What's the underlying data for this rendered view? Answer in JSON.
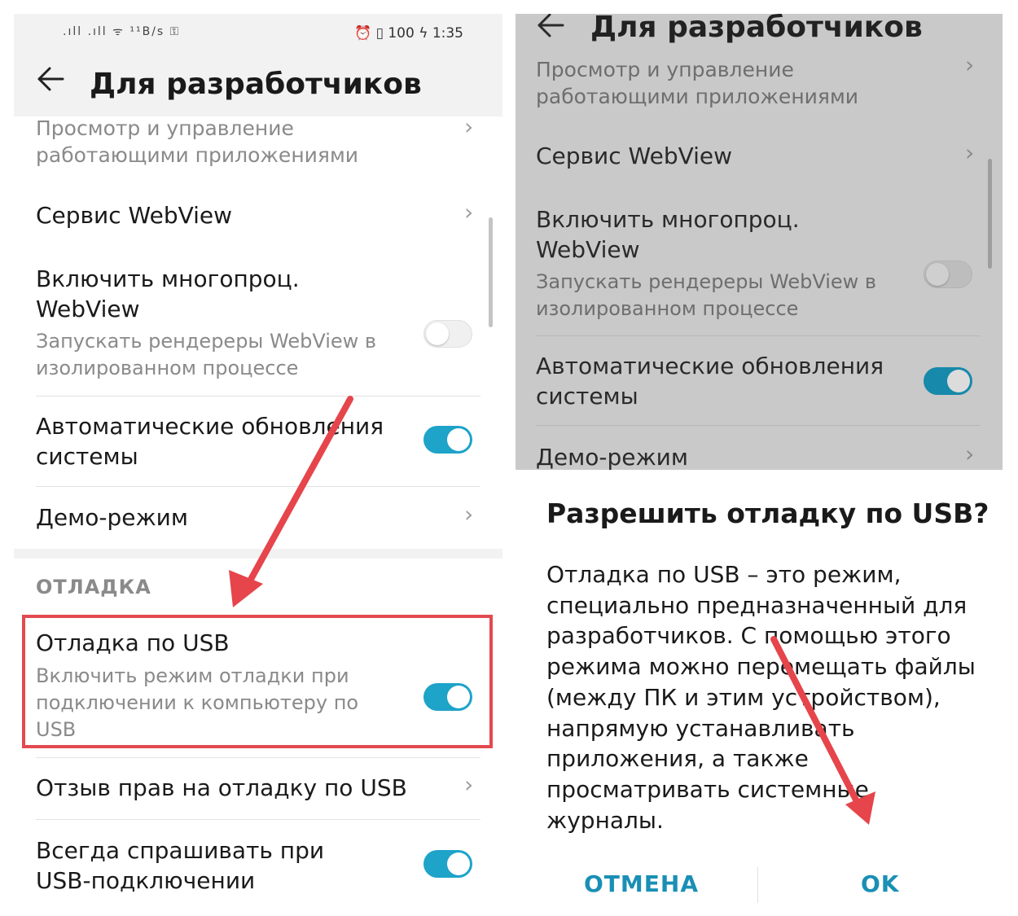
{
  "left": {
    "status_bar": {
      "left_icons": ".ıll  .ıll ᯤ ¹¹B/s  ⚿",
      "right_icons": "⏰ ▯ 100",
      "time": "1:35"
    },
    "header": {
      "title": "Для разработчиков"
    },
    "items": {
      "running_apps": {
        "title_line1": "Просмотр и управление",
        "title_line2": "работающими приложениями"
      },
      "webview": {
        "title": "Сервис WebView"
      },
      "multiprocess": {
        "title_line1": "Включить многопроц.",
        "title_line2": "WebView",
        "sub_line1": "Запускать рендереры WebView в",
        "sub_line2": "изолированном процессе",
        "toggle_on": false
      },
      "auto_updates": {
        "title_line1": "Автоматические обновления",
        "title_line2": "системы",
        "toggle_on": true
      },
      "demo": {
        "title": "Демо-режим"
      },
      "section_debug": "ОТЛАДКА",
      "usb_debug": {
        "title": "Отладка по USB",
        "sub_line1": "Включить режим отладки при",
        "sub_line2": "подключении к компьютеру по",
        "sub_line3": "USB",
        "toggle_on": true
      },
      "revoke": {
        "title": "Отзыв прав на отладку по USB"
      },
      "always_ask": {
        "title_line1": "Всегда спрашивать при",
        "title_line2": "USB-подключении",
        "toggle_on": true
      }
    }
  },
  "right": {
    "header": {
      "title": "Для разработчиков"
    },
    "items": {
      "running_apps": {
        "title_line1": "Просмотр и управление",
        "title_line2": "работающими приложениями"
      },
      "webview": {
        "title": "Сервис WebView"
      },
      "multiprocess": {
        "title_line1": "Включить многопроц.",
        "title_line2": "WebView",
        "sub_line1": "Запускать рендереры WebView в",
        "sub_line2": "изолированном процессе",
        "toggle_on": false
      },
      "auto_updates": {
        "title_line1": "Автоматические обновления",
        "title_line2": "системы",
        "toggle_on": true
      },
      "demo": {
        "title": "Демо-режим"
      }
    },
    "dialog": {
      "title": "Разрешить отладку по USB?",
      "body": "Отладка по USB – это режим, специально предназначенный для разработчиков. С помощью этого режима можно перемещать файлы (между ПК и этим устройством), напрямую устанавливать приложения, а также просматривать системные журналы.",
      "cancel": "ОТМЕНА",
      "ok": "OK"
    }
  },
  "colors": {
    "accent": "#1ea3c9",
    "highlight_red": "#e24a4f",
    "arrow_red": "#e5454b"
  },
  "icons": {
    "back": "arrow-left-icon",
    "chevron": "chevron-right-icon"
  }
}
